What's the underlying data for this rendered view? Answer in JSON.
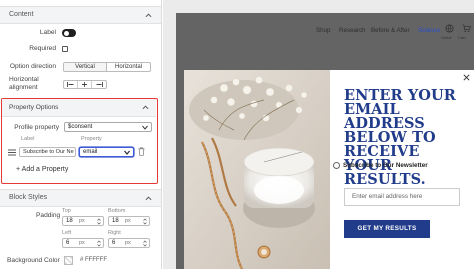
{
  "panel": {
    "content": {
      "title": "Content",
      "label_label": "Label",
      "required_label": "Required",
      "option_direction_label": "Option direction",
      "direction_options": [
        "Vertical",
        "Horizontal"
      ],
      "direction_selected": "Vertical",
      "horizontal_alignment_label_1": "Horizontal",
      "horizontal_alignment_label_2": "alignment",
      "alignment_icons": [
        "align-left",
        "align-center",
        "align-right"
      ]
    },
    "property_options": {
      "title": "Property Options",
      "profile_property_label": "Profile property",
      "profile_property_value": "$consent",
      "label_caption": "Label",
      "property_caption": "Property",
      "row_label_value": "Subscribe to Our Ne",
      "row_property_value": "email",
      "add_property_label": "+ Add a Property"
    },
    "block_styles": {
      "title": "Block Styles",
      "padding_label": "Padding",
      "top_caption": "Top",
      "bottom_caption": "Bottom",
      "left_caption": "Left",
      "right_caption": "Right",
      "top_value": "18",
      "bottom_value": "18",
      "left_value": "6",
      "right_value": "6",
      "unit": "px",
      "background_color_label": "Background Color",
      "background_color_value": "# FFFFFF"
    }
  },
  "preview": {
    "nav": {
      "links": [
        "Shop",
        "Research",
        "Before & After",
        "Science"
      ],
      "active": "Science",
      "account_labels": [
        "Globe",
        "Cart"
      ]
    },
    "popup": {
      "headline": "ENTER YOUR EMAIL ADDRESS BELOW TO RECEIVE YOUR RESULTS.",
      "newsletter_label": "Subscribe to Our Newsletter",
      "email_placeholder": "Enter email address here",
      "cta_label": "GET MY RESULTS"
    }
  },
  "colors": {
    "accent_red": "#e53935",
    "brand_blue": "#203c8a",
    "nav_active": "#2a4fd2",
    "page_overlay": "#646464"
  }
}
